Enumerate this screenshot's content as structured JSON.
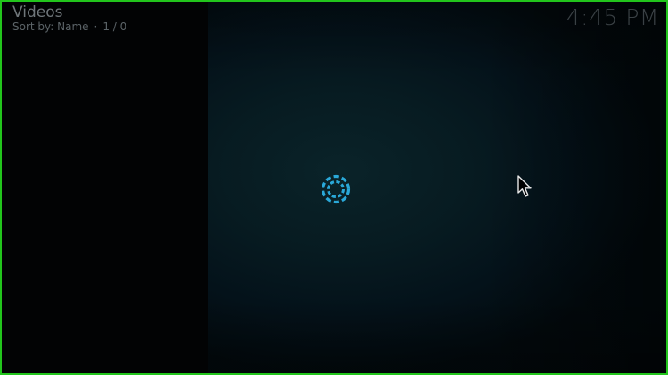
{
  "header": {
    "title": "Videos",
    "sort_label": "Sort by: Name",
    "separator": "·",
    "position": "1 / 0"
  },
  "clock": {
    "time": "4:45 PM"
  },
  "loading": {
    "icon": "busy-spinner-icon",
    "color": "#2aa8d8"
  },
  "pointer": {
    "icon": "mouse-pointer-icon"
  },
  "colors": {
    "frame_border": "#22c51c",
    "accent": "#2aa8d8"
  }
}
